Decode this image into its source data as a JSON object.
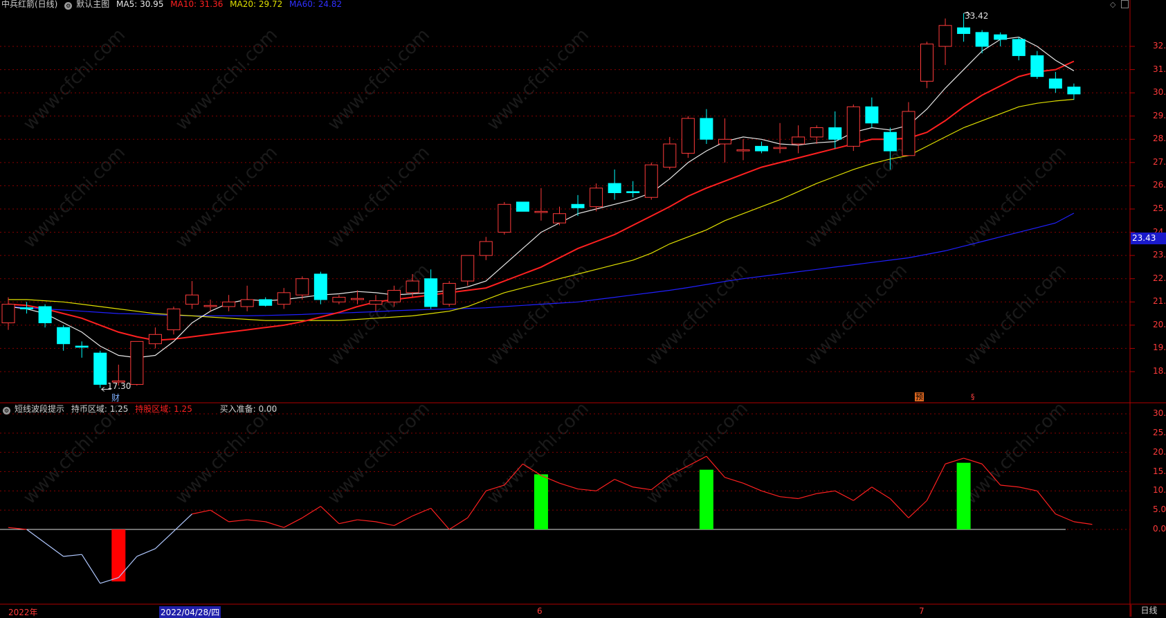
{
  "main_header": {
    "stock_title": "中兵红箭(日线)",
    "template": "默认主图",
    "ma5": "MA5: 30.95",
    "ma10": "MA10: 31.36",
    "ma20": "MA20: 29.72",
    "ma60": "MA60: 24.82"
  },
  "sub_header": {
    "indicator": "短线波段提示",
    "hold_coin": "持币区域: 1.25",
    "hold_stock": "持股区域: 1.25",
    "buy_ready": "买入准备: 0.00"
  },
  "current_price": "23.43",
  "period_button": "日线",
  "markers": {
    "cai": "财",
    "yu": "预",
    "s": "§",
    "high_label": "33.42",
    "low_label": "17.30"
  },
  "x_labels": {
    "year": "2022年",
    "cursor_date": "2022/04/28/四",
    "june": "6",
    "july": "7"
  },
  "colors": {
    "up": "#ff3b3b",
    "down": "#00ffff",
    "ma5": "#e8e8e8",
    "ma10": "#ff2020",
    "ma20": "#e0e000",
    "ma60": "#2020ff",
    "buy_bar": "#00ff00",
    "sell_bar": "#ff0000"
  },
  "chart_data": [
    {
      "type": "candlestick",
      "title": "中兵红箭(日线)",
      "yticks": [
        "32.00",
        "31.00",
        "30.00",
        "29.00",
        "28.00",
        "27.00",
        "26.00",
        "25.00",
        "24.00",
        "23.00",
        "22.00",
        "21.00",
        "20.00",
        "19.00",
        "18.00"
      ],
      "ylim": [
        16.8,
        33.7
      ],
      "candles": [
        {
          "o": 20.1,
          "h": 21.2,
          "l": 19.8,
          "c": 20.9
        },
        {
          "o": 20.75,
          "h": 21.0,
          "l": 20.5,
          "c": 20.7
        },
        {
          "o": 20.8,
          "h": 20.9,
          "l": 19.9,
          "c": 20.1
        },
        {
          "o": 19.9,
          "h": 20.0,
          "l": 18.9,
          "c": 19.2
        },
        {
          "o": 19.1,
          "h": 19.3,
          "l": 18.6,
          "c": 19.05
        },
        {
          "o": 18.8,
          "h": 18.9,
          "l": 17.3,
          "c": 17.45
        },
        {
          "o": 17.55,
          "h": 18.3,
          "l": 17.4,
          "c": 17.6
        },
        {
          "o": 17.45,
          "h": 19.3,
          "l": 17.4,
          "c": 19.3
        },
        {
          "o": 19.2,
          "h": 19.9,
          "l": 19.0,
          "c": 19.6
        },
        {
          "o": 19.8,
          "h": 20.8,
          "l": 19.6,
          "c": 20.7
        },
        {
          "o": 20.9,
          "h": 21.9,
          "l": 20.7,
          "c": 21.3
        },
        {
          "o": 20.8,
          "h": 21.1,
          "l": 20.6,
          "c": 20.85
        },
        {
          "o": 20.8,
          "h": 21.3,
          "l": 20.6,
          "c": 21.0
        },
        {
          "o": 20.8,
          "h": 21.7,
          "l": 20.6,
          "c": 21.1
        },
        {
          "o": 21.1,
          "h": 21.2,
          "l": 20.8,
          "c": 20.85
        },
        {
          "o": 20.9,
          "h": 21.6,
          "l": 20.7,
          "c": 21.4
        },
        {
          "o": 21.3,
          "h": 22.1,
          "l": 21.1,
          "c": 22.0
        },
        {
          "o": 22.2,
          "h": 22.3,
          "l": 20.9,
          "c": 21.1
        },
        {
          "o": 21.0,
          "h": 21.3,
          "l": 20.9,
          "c": 21.2
        },
        {
          "o": 21.1,
          "h": 21.5,
          "l": 20.9,
          "c": 21.15
        },
        {
          "o": 20.9,
          "h": 21.3,
          "l": 20.6,
          "c": 21.05
        },
        {
          "o": 21.0,
          "h": 21.7,
          "l": 20.8,
          "c": 21.5
        },
        {
          "o": 21.4,
          "h": 22.2,
          "l": 21.2,
          "c": 21.9
        },
        {
          "o": 22.0,
          "h": 22.4,
          "l": 20.7,
          "c": 20.8
        },
        {
          "o": 20.9,
          "h": 21.9,
          "l": 20.8,
          "c": 21.8
        },
        {
          "o": 21.9,
          "h": 23.0,
          "l": 21.7,
          "c": 23.0
        },
        {
          "o": 23.0,
          "h": 23.8,
          "l": 22.8,
          "c": 23.6
        },
        {
          "o": 24.0,
          "h": 25.3,
          "l": 23.9,
          "c": 25.2
        },
        {
          "o": 25.3,
          "h": 25.3,
          "l": 24.9,
          "c": 24.9
        },
        {
          "o": 24.85,
          "h": 25.9,
          "l": 24.5,
          "c": 24.9
        },
        {
          "o": 24.4,
          "h": 25.1,
          "l": 24.3,
          "c": 24.8
        },
        {
          "o": 25.2,
          "h": 25.6,
          "l": 24.7,
          "c": 25.05
        },
        {
          "o": 25.1,
          "h": 26.1,
          "l": 24.9,
          "c": 25.9
        },
        {
          "o": 26.1,
          "h": 26.7,
          "l": 25.4,
          "c": 25.7
        },
        {
          "o": 25.75,
          "h": 26.2,
          "l": 25.5,
          "c": 25.7
        },
        {
          "o": 25.5,
          "h": 27.0,
          "l": 25.4,
          "c": 26.9
        },
        {
          "o": 26.8,
          "h": 28.1,
          "l": 26.7,
          "c": 27.8
        },
        {
          "o": 27.4,
          "h": 29.0,
          "l": 27.2,
          "c": 28.9
        },
        {
          "o": 28.9,
          "h": 29.3,
          "l": 27.8,
          "c": 28.0
        },
        {
          "o": 27.8,
          "h": 28.9,
          "l": 27.0,
          "c": 28.0
        },
        {
          "o": 27.5,
          "h": 28.0,
          "l": 27.1,
          "c": 27.55
        },
        {
          "o": 27.7,
          "h": 27.9,
          "l": 27.4,
          "c": 27.5
        },
        {
          "o": 27.6,
          "h": 28.7,
          "l": 27.4,
          "c": 27.65
        },
        {
          "o": 27.8,
          "h": 28.6,
          "l": 27.4,
          "c": 28.1
        },
        {
          "o": 28.1,
          "h": 28.6,
          "l": 27.8,
          "c": 28.5
        },
        {
          "o": 28.5,
          "h": 29.2,
          "l": 27.6,
          "c": 28.0
        },
        {
          "o": 27.7,
          "h": 29.5,
          "l": 27.5,
          "c": 29.4
        },
        {
          "o": 29.4,
          "h": 29.8,
          "l": 28.5,
          "c": 28.7
        },
        {
          "o": 28.3,
          "h": 28.5,
          "l": 26.7,
          "c": 27.5
        },
        {
          "o": 27.3,
          "h": 29.6,
          "l": 27.3,
          "c": 29.2
        },
        {
          "o": 30.5,
          "h": 32.2,
          "l": 30.2,
          "c": 32.1
        },
        {
          "o": 32.0,
          "h": 33.2,
          "l": 31.2,
          "c": 32.9
        },
        {
          "o": 32.8,
          "h": 33.42,
          "l": 32.2,
          "c": 32.55
        },
        {
          "o": 32.6,
          "h": 32.7,
          "l": 31.7,
          "c": 32.0
        },
        {
          "o": 32.5,
          "h": 32.6,
          "l": 32.0,
          "c": 32.3
        },
        {
          "o": 32.3,
          "h": 32.4,
          "l": 31.4,
          "c": 31.6
        },
        {
          "o": 31.6,
          "h": 31.8,
          "l": 30.6,
          "c": 30.7
        },
        {
          "o": 30.6,
          "h": 30.9,
          "l": 30.0,
          "c": 30.2
        },
        {
          "o": 30.25,
          "h": 30.4,
          "l": 29.7,
          "c": 29.95
        }
      ],
      "ma5": [
        20.8,
        20.7,
        20.5,
        20.1,
        19.7,
        19.1,
        18.7,
        18.6,
        18.7,
        19.3,
        20.1,
        20.6,
        20.95,
        21.1,
        21.05,
        21.1,
        21.2,
        21.3,
        21.35,
        21.45,
        21.4,
        21.3,
        21.35,
        21.4,
        21.5,
        21.65,
        21.9,
        22.6,
        23.3,
        24.0,
        24.4,
        24.8,
        25.0,
        25.2,
        25.4,
        25.7,
        26.3,
        27.0,
        27.5,
        27.9,
        28.1,
        28.0,
        27.8,
        27.75,
        27.85,
        27.9,
        28.3,
        28.5,
        28.4,
        28.6,
        29.3,
        30.2,
        31.0,
        31.8,
        32.3,
        32.4,
        32.0,
        31.4,
        30.95
      ],
      "ma10": [
        20.9,
        20.85,
        20.7,
        20.5,
        20.3,
        20.0,
        19.7,
        19.5,
        19.35,
        19.4,
        19.5,
        19.6,
        19.7,
        19.8,
        19.9,
        20.0,
        20.15,
        20.35,
        20.55,
        20.8,
        21.0,
        21.1,
        21.2,
        21.3,
        21.4,
        21.5,
        21.6,
        21.9,
        22.2,
        22.5,
        22.9,
        23.3,
        23.6,
        23.9,
        24.3,
        24.7,
        25.1,
        25.55,
        25.9,
        26.2,
        26.5,
        26.8,
        27.0,
        27.2,
        27.4,
        27.6,
        27.8,
        28.0,
        28.0,
        28.05,
        28.3,
        28.8,
        29.4,
        29.9,
        30.3,
        30.7,
        30.9,
        31.0,
        31.36
      ],
      "ma20": [
        21.1,
        21.1,
        21.05,
        21.0,
        20.9,
        20.8,
        20.7,
        20.6,
        20.5,
        20.45,
        20.4,
        20.35,
        20.3,
        20.25,
        20.2,
        20.2,
        20.2,
        20.2,
        20.2,
        20.25,
        20.3,
        20.35,
        20.4,
        20.5,
        20.6,
        20.8,
        21.1,
        21.4,
        21.6,
        21.8,
        22.0,
        22.2,
        22.4,
        22.6,
        22.8,
        23.1,
        23.5,
        23.8,
        24.1,
        24.5,
        24.8,
        25.1,
        25.4,
        25.75,
        26.1,
        26.4,
        26.7,
        26.95,
        27.15,
        27.3,
        27.7,
        28.1,
        28.5,
        28.8,
        29.1,
        29.4,
        29.55,
        29.65,
        29.72
      ],
      "ma60": [
        20.8,
        20.75,
        20.7,
        20.65,
        20.6,
        20.55,
        20.5,
        20.48,
        20.45,
        20.42,
        20.4,
        20.4,
        20.4,
        20.4,
        20.42,
        20.44,
        20.46,
        20.5,
        20.52,
        20.55,
        20.58,
        20.62,
        20.65,
        20.68,
        20.7,
        20.72,
        20.75,
        20.8,
        20.85,
        20.9,
        20.95,
        21.0,
        21.1,
        21.2,
        21.3,
        21.4,
        21.5,
        21.62,
        21.75,
        21.88,
        22.0,
        22.1,
        22.2,
        22.3,
        22.4,
        22.5,
        22.6,
        22.7,
        22.8,
        22.9,
        23.05,
        23.2,
        23.4,
        23.6,
        23.8,
        24.0,
        24.2,
        24.4,
        24.82
      ]
    },
    {
      "type": "bar",
      "title": "短线波段提示",
      "yticks": [
        "30.00",
        "25.00",
        "20.00",
        "15.00",
        "10.00",
        "5.00",
        "0.00"
      ],
      "ylim": [
        -20,
        32
      ],
      "line_values": [
        0.5,
        0,
        -3.5,
        -7,
        -6.5,
        -14,
        -12.5,
        -7,
        -5,
        -0.5,
        4,
        5,
        2,
        2.5,
        2,
        0.5,
        3,
        6,
        1.5,
        2.5,
        2,
        1,
        3.5,
        5.5,
        0,
        3,
        10,
        11.5,
        17,
        14,
        12,
        10.5,
        10,
        13,
        11,
        10.3,
        14,
        16.5,
        19,
        13.5,
        12,
        10,
        8.5,
        8,
        9.3,
        10,
        7.5,
        11,
        8,
        3,
        7.5,
        17,
        18.5,
        17,
        11.5,
        11,
        10,
        4,
        2,
        1.3
      ],
      "bars": [
        {
          "index": 6,
          "value": -13.5,
          "kind": "sell"
        },
        {
          "index": 29,
          "value": 14.3,
          "kind": "buy"
        },
        {
          "index": 38,
          "value": 15.5,
          "kind": "buy"
        },
        {
          "index": 52,
          "value": 17.3,
          "kind": "buy"
        }
      ]
    }
  ]
}
